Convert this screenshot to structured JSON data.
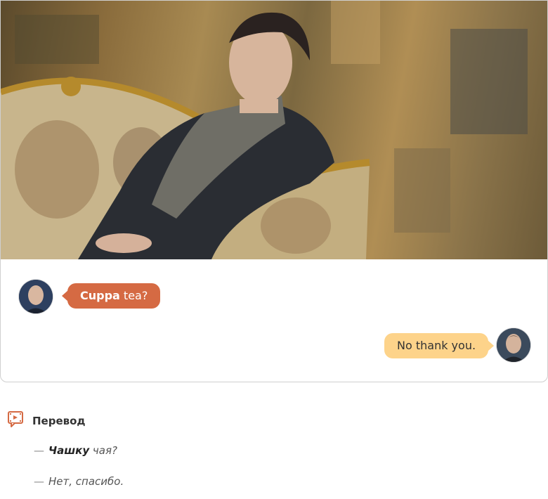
{
  "dialogue": [
    {
      "speaker": "left",
      "bold": "Cuppa",
      "rest": " tea?"
    },
    {
      "speaker": "right",
      "text": "No thank you."
    }
  ],
  "translation": {
    "title": "Перевод",
    "icon": "film-icon",
    "lines": [
      {
        "dash": "—",
        "bold": "Чашку",
        "rest": " чая?"
      },
      {
        "dash": "—",
        "text": "Нет, спасибо."
      }
    ]
  },
  "colors": {
    "bubble_left": "#d56a43",
    "bubble_right": "#fdd38a",
    "accent": "#d56a43"
  }
}
